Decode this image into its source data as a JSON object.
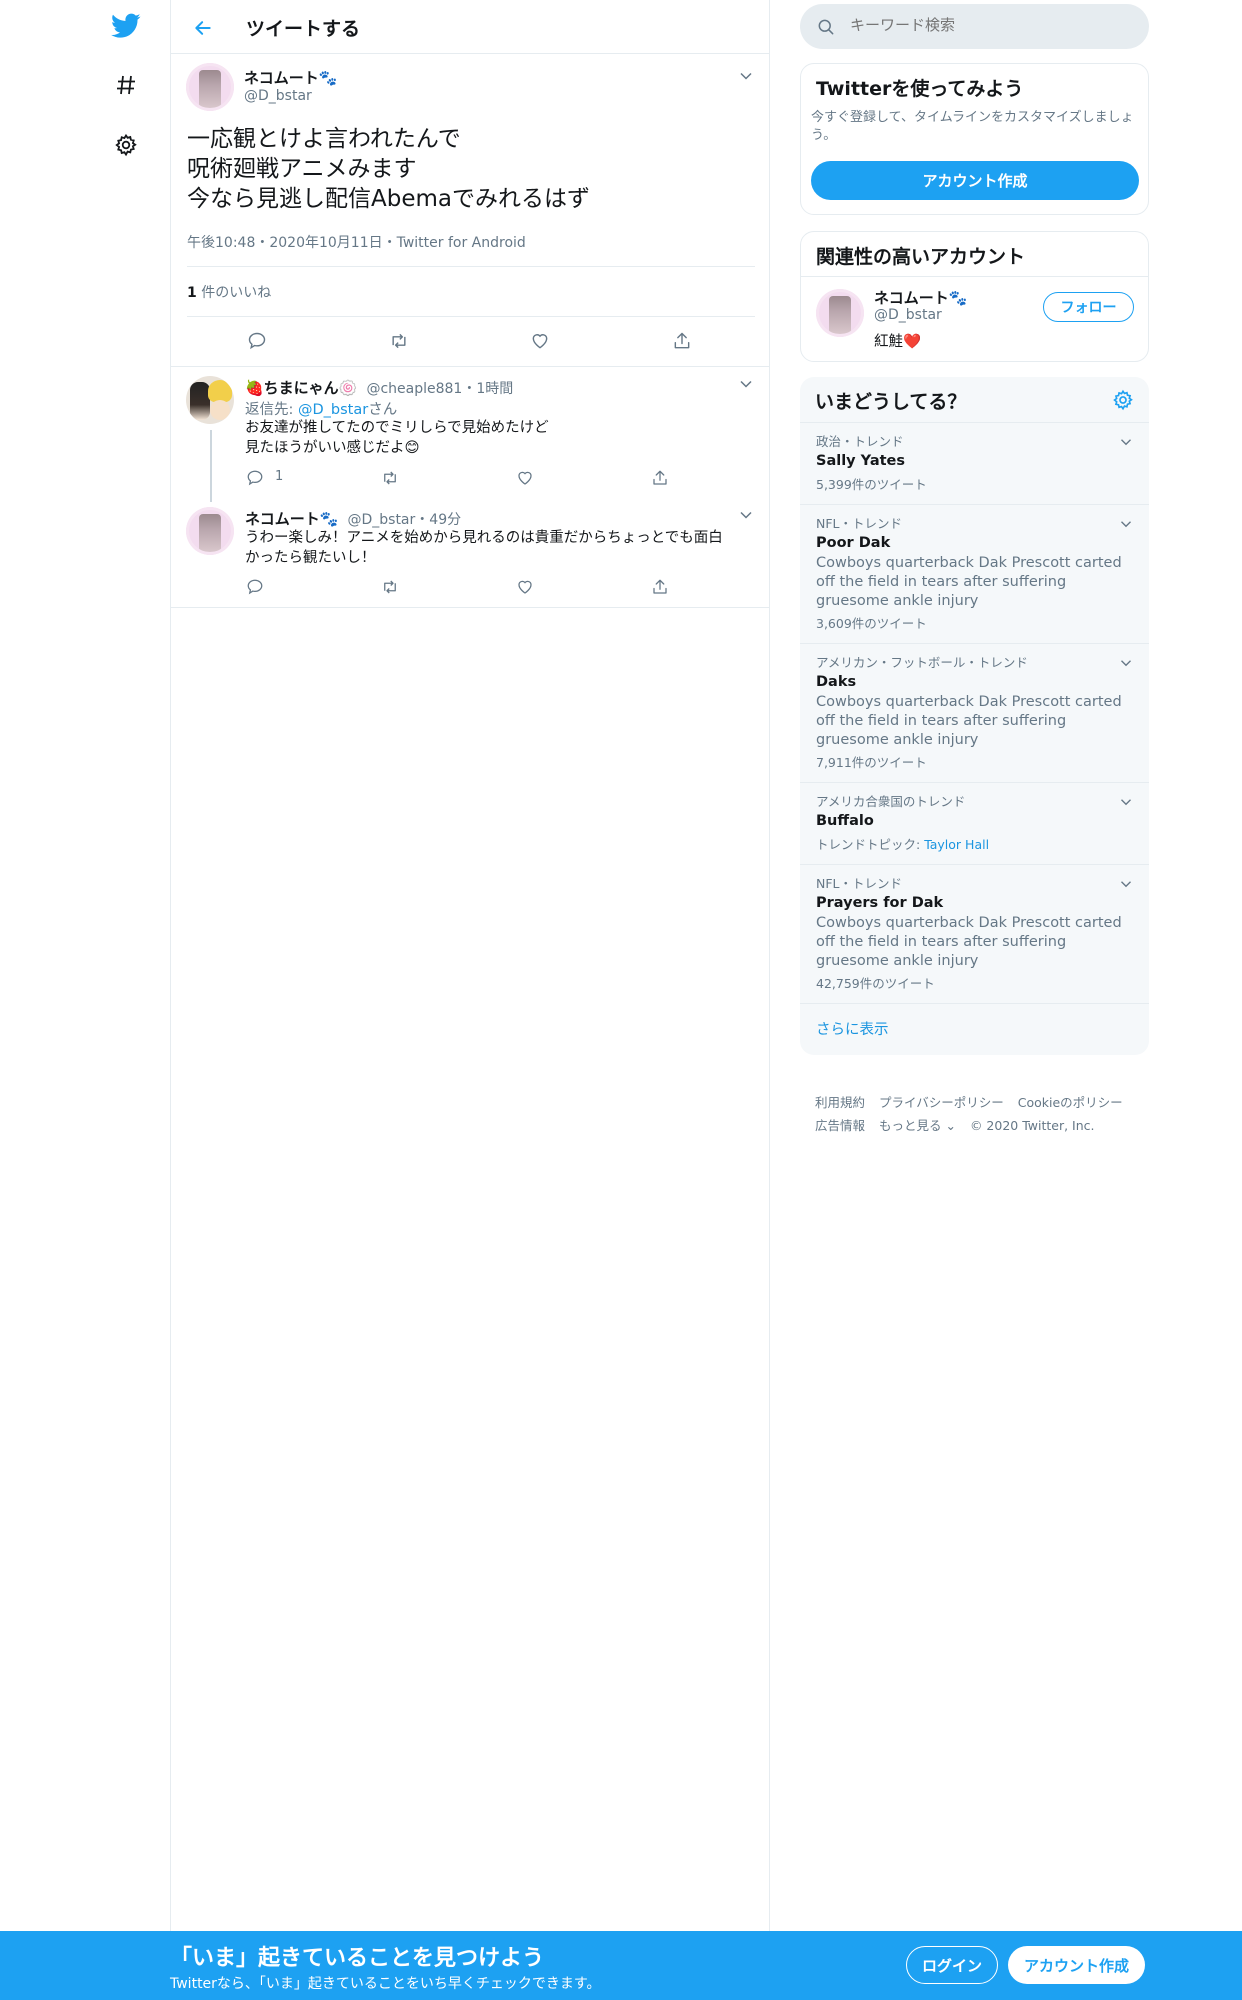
{
  "colors": {
    "accent": "#1da1f2",
    "text": "#14171a",
    "muted": "#657786",
    "border": "#e6ecf0",
    "heart": "#e0245e"
  },
  "nav": {
    "icons": [
      "twitter-logo-icon",
      "hashtag-icon",
      "gear-icon"
    ]
  },
  "header": {
    "title": "ツイートする"
  },
  "main_tweet": {
    "name": "ネコムート🐾",
    "handle": "@D_bstar",
    "lines": [
      "一応観とけよ言われたんで",
      "呪術廻戦アニメみます",
      "今なら見逃し配信Abemaでみれるはず"
    ],
    "meta": "午後10:48・2020年10月11日・Twitter for Android",
    "likes_count": "1",
    "likes_label": " 件のいいね"
  },
  "replies": [
    {
      "name": "🍓ちまにゃん🍥",
      "handle": "@cheaple881",
      "time": "・1時間",
      "reply_to_prefix": "返信先: ",
      "reply_to_handle": "@D_bstar",
      "reply_to_suffix": "さん",
      "lines": [
        "お友達が推してたのでミリしらで見始めたけど",
        "見たほうがいい感じだよ😊"
      ],
      "reply_count": "1"
    },
    {
      "name": "ネコムート🐾",
      "handle": "@D_bstar",
      "time": "・49分",
      "lines": [
        "うわー楽しみ！アニメを始めから見れるのは貴重だからちょっとでも面白",
        "かったら観たいし！"
      ]
    }
  ],
  "search": {
    "placeholder": "キーワード検索"
  },
  "signup_card": {
    "title": "Twitterを使ってみよう",
    "body_lines": [
      "今すぐ登録して、タイムラインをカスタマイズしましょ",
      "う。"
    ],
    "button": "アカウント作成"
  },
  "related": {
    "title": "関連性の高いアカウント",
    "name": "ネコムート🐾",
    "handle": "@D_bstar",
    "bio": "紅鮭❤️",
    "follow": "フォロー"
  },
  "trends": {
    "title": "いまどうしてる？",
    "items": [
      {
        "context": "政治・トレンド",
        "name": "Sally Yates",
        "desc": "",
        "count": "5,399件のツイート"
      },
      {
        "context": "NFL・トレンド",
        "name": "Poor Dak",
        "desc": "Cowboys quarterback Dak Prescott carted off the field in tears after suffering gruesome ankle injury",
        "count": "3,609件のツイート"
      },
      {
        "context": "アメリカン・フットボール・トレンド",
        "name": "Daks",
        "desc": "Cowboys quarterback Dak Prescott carted off the field in tears after suffering gruesome ankle injury",
        "count": "7,911件のツイート"
      },
      {
        "context": "アメリカ合衆国のトレンド",
        "name": "Buffalo",
        "desc": "",
        "count": "",
        "topic_label": "トレンドトピック: ",
        "topic": "Taylor Hall"
      },
      {
        "context": "NFL・トレンド",
        "name": "Prayers for Dak",
        "desc": "Cowboys quarterback Dak Prescott carted off the field in tears after suffering gruesome ankle injury",
        "count": "42,759件のツイート"
      }
    ],
    "show_more": "さらに表示"
  },
  "footer": {
    "row1": [
      "利用規約",
      "プライバシーポリシー",
      "Cookieのポリシー"
    ],
    "row2": [
      "広告情報",
      "もっと見る ⌄",
      "© 2020 Twitter, Inc."
    ]
  },
  "bottom_bar": {
    "title": "「いま」起きていることを見つけよう",
    "subtitle": "Twitterなら、「いま」起きていることをいち早くチェックできます。",
    "login": "ログイン",
    "signup": "アカウント作成"
  }
}
